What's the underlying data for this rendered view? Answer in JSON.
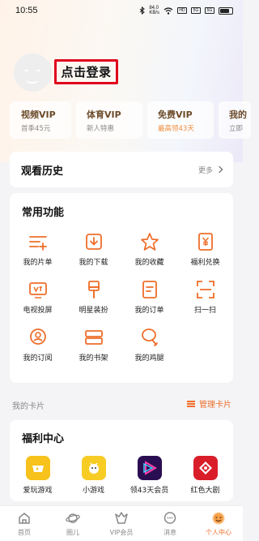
{
  "status_bar": {
    "time": "10:55",
    "network_speed": "84.0\nKB/s",
    "signal_labels": [
      "HD",
      "5G",
      "5G"
    ]
  },
  "login": {
    "label": "点击登录"
  },
  "vip_cards": [
    {
      "title": "视频VIP",
      "subtitle": "首季45元",
      "subtitle_color": "gray"
    },
    {
      "title": "体育VIP",
      "subtitle": "新人特惠",
      "subtitle_color": "gray"
    },
    {
      "title": "免费VIP",
      "subtitle": "最高领43天",
      "subtitle_color": "orange"
    },
    {
      "title": "我的",
      "subtitle": "立即",
      "subtitle_color": "gray"
    }
  ],
  "history": {
    "title": "观看历史",
    "more_label": "更多"
  },
  "functions": {
    "title": "常用功能",
    "items": [
      {
        "label": "我的片单",
        "icon": "playlist-icon"
      },
      {
        "label": "我的下载",
        "icon": "download-icon"
      },
      {
        "label": "我的收藏",
        "icon": "star-icon"
      },
      {
        "label": "福利兑换",
        "icon": "yen-icon"
      },
      {
        "label": "电视投屏",
        "icon": "tv-icon"
      },
      {
        "label": "明星装扮",
        "icon": "brush-icon"
      },
      {
        "label": "我的订单",
        "icon": "order-icon"
      },
      {
        "label": "扫一扫",
        "icon": "scan-icon"
      },
      {
        "label": "我的订阅",
        "icon": "subscribe-icon"
      },
      {
        "label": "我的书架",
        "icon": "bookshelf-icon"
      },
      {
        "label": "我的鸡腿",
        "icon": "drumstick-icon"
      }
    ]
  },
  "my_cards": {
    "title": "我的卡片",
    "manage_label": "管理卡片"
  },
  "welfare": {
    "title": "福利中心",
    "items": [
      {
        "label": "爱玩游戏",
        "icon": "game-icon",
        "color": "#f6c21b"
      },
      {
        "label": "小游戏",
        "icon": "minigame-icon",
        "color": "#f7cc25"
      },
      {
        "label": "领43天会员",
        "icon": "play-logo-icon",
        "color": "#2a0e52"
      },
      {
        "label": "红色大剧",
        "icon": "red-drama-icon",
        "color": "#d91e2a"
      }
    ]
  },
  "bottom_nav": [
    {
      "label": "首页",
      "icon": "home-icon",
      "active": false
    },
    {
      "label": "圈儿",
      "icon": "planet-icon",
      "active": false
    },
    {
      "label": "VIP会员",
      "icon": "vip-crown-icon",
      "active": false
    },
    {
      "label": "消息",
      "icon": "message-icon",
      "active": false
    },
    {
      "label": "个人中心",
      "icon": "profile-icon",
      "active": true
    }
  ],
  "colors": {
    "accent": "#ee6e2a",
    "login_highlight": "#e0001c",
    "vip_text": "#6b4b2a"
  }
}
